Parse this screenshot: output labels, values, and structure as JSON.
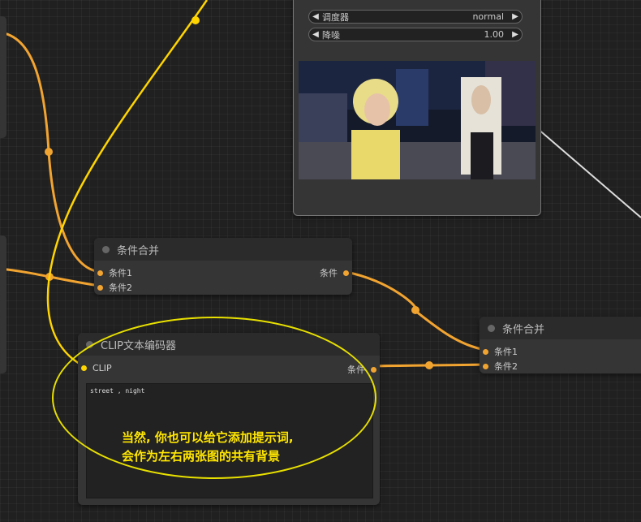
{
  "sampler_node": {
    "widgets": [
      {
        "label": "调度器",
        "value": "normal"
      },
      {
        "label": "降噪",
        "value": "1.00"
      }
    ]
  },
  "cond_combine_1": {
    "title": "条件合并",
    "inputs": [
      "条件1",
      "条件2"
    ],
    "output": "条件"
  },
  "cond_combine_2": {
    "title": "条件合并",
    "inputs": [
      "条件1",
      "条件2"
    ]
  },
  "clip_encoder": {
    "title": "CLIP文本编码器",
    "input": "CLIP",
    "output": "条件",
    "prompt": "street , night"
  },
  "annotation": {
    "line1": "当然, 你也可以给它添加提示词,",
    "line2": "会作为左右两张图的共有背景"
  },
  "colors": {
    "conditioning_wire": "#f2a431",
    "clip_wire": "#ffd500",
    "image_wire": "#dddddd",
    "annotation": "#ffe600"
  }
}
